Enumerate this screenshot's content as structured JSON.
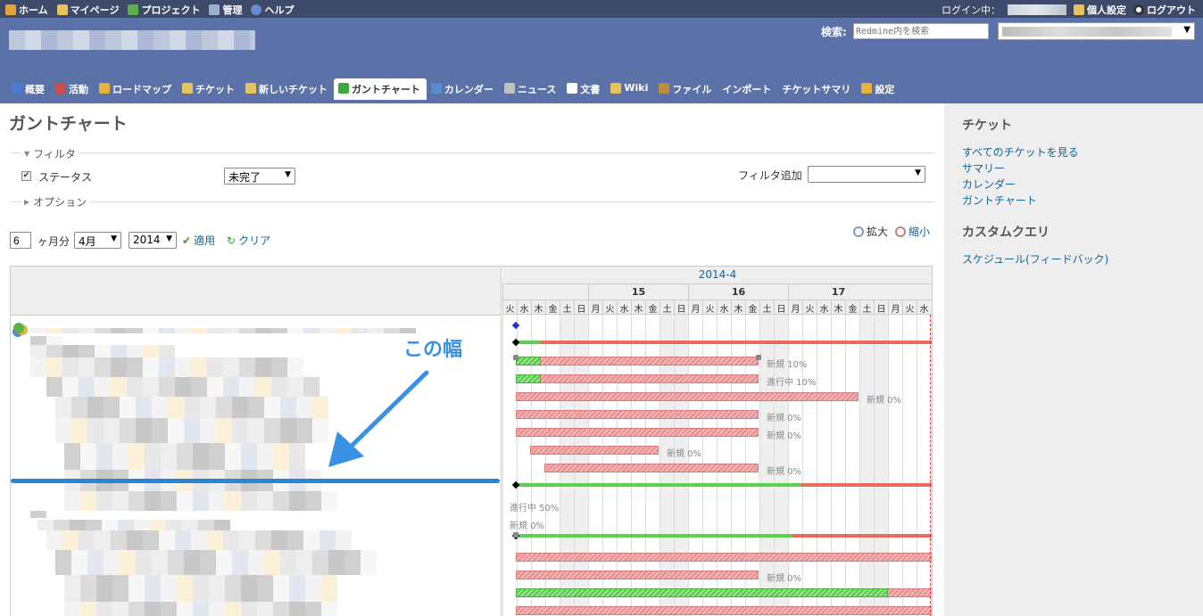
{
  "top_menu": {
    "home": "ホーム",
    "my_page": "マイページ",
    "projects": "プロジェクト",
    "admin": "管理",
    "help": "ヘルプ",
    "logged_in_as": "ログイン中：",
    "my_account": "個人設定",
    "logout": "ログアウト"
  },
  "header": {
    "search_label": "検索:",
    "search_placeholder": "Redmine内を検索"
  },
  "tabs": [
    {
      "label": "概要",
      "icon": "info-icon",
      "color": "#4a7bd0"
    },
    {
      "label": "活動",
      "icon": "activity-icon",
      "color": "#d04a4a"
    },
    {
      "label": "ロードマップ",
      "icon": "package-icon",
      "color": "#e8b23a"
    },
    {
      "label": "チケット",
      "icon": "ticket-icon",
      "color": "#e8c25a"
    },
    {
      "label": "新しいチケット",
      "icon": "new-ticket-icon",
      "color": "#e8c25a"
    },
    {
      "label": "ガントチャート",
      "icon": "gantt-icon",
      "color": "#3aa83a",
      "selected": true
    },
    {
      "label": "カレンダー",
      "icon": "calendar-icon",
      "color": "#5a8ad0"
    },
    {
      "label": "ニュース",
      "icon": "news-icon",
      "color": "#c0c0c0"
    },
    {
      "label": "文書",
      "icon": "document-icon",
      "color": "#ffffff"
    },
    {
      "label": "Wiki",
      "icon": "wiki-icon",
      "color": "#e8c25a"
    },
    {
      "label": "ファイル",
      "icon": "file-icon",
      "color": "#c08a3a"
    },
    {
      "label": "インポート",
      "icon": "",
      "color": ""
    },
    {
      "label": "チケットサマリ",
      "icon": "",
      "color": ""
    },
    {
      "label": "設定",
      "icon": "settings-icon",
      "color": "#e8b23a"
    }
  ],
  "content": {
    "title": "ガントチャート",
    "filter_legend": "フィルタ",
    "status_label": "ステータス",
    "status_value": "未完了",
    "add_filter_label": "フィルタ追加",
    "options_legend": "オプション",
    "months_value": "6",
    "months_label": "ヶ月分",
    "month_select": "4月",
    "year_select": "2014",
    "apply": "適用",
    "clear": "クリア",
    "zoom_in": "拡大",
    "zoom_out": "縮小"
  },
  "gantt": {
    "month_label": "2014-4",
    "weeks": [
      "15",
      "16",
      "17"
    ],
    "days": [
      "火",
      "水",
      "木",
      "金",
      "土",
      "日",
      "月",
      "火",
      "水",
      "木",
      "金",
      "土",
      "日",
      "月",
      "火",
      "水",
      "木",
      "金",
      "土",
      "日",
      "月",
      "火",
      "水",
      "木",
      "金",
      "土",
      "日",
      "月",
      "火",
      "水"
    ],
    "bar_labels": {
      "l1": "新規 10%",
      "l2": "進行中 10%",
      "l3": "新規 0%",
      "l4": "新規 0%",
      "l5": "新規 0%",
      "l6": "新規 0%",
      "l7": "新規 0%",
      "l8": "進行中 50%",
      "l9": "新規 0%",
      "l10": "新規 0%"
    }
  },
  "annotation": {
    "text": "この幅"
  },
  "sidebar": {
    "tickets_heading": "チケット",
    "links": [
      "すべてのチケットを見る",
      "サマリー",
      "カレンダー",
      "ガントチャート"
    ],
    "custom_heading": "カスタムクエリ",
    "custom_links": [
      "スケジュール(フィードバック)"
    ]
  }
}
